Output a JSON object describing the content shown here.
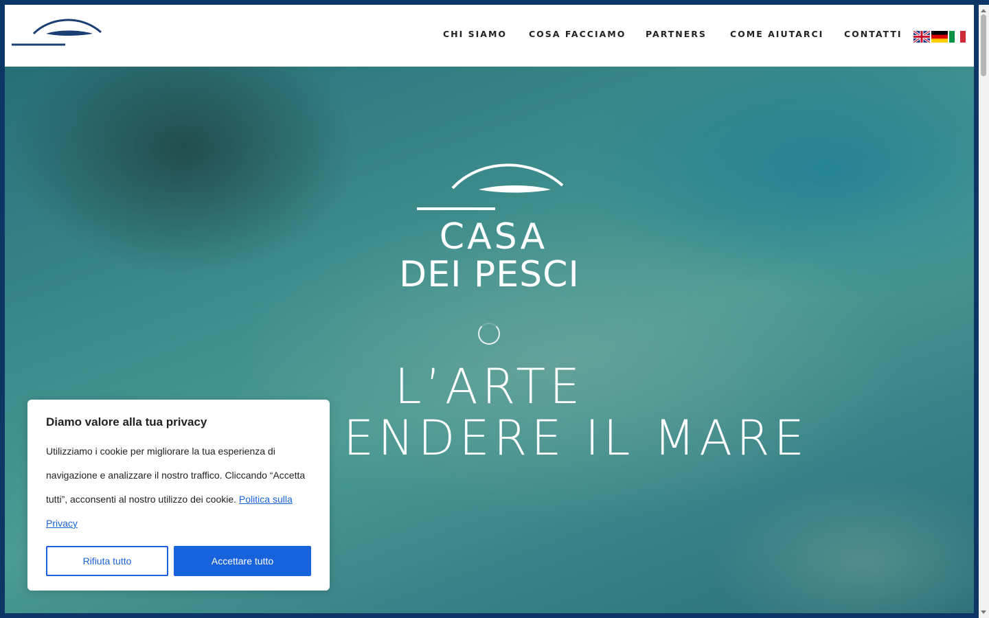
{
  "nav": {
    "items": [
      {
        "label": "CHI SIAMO"
      },
      {
        "label": "COSA FACCIAMO"
      },
      {
        "label": "PARTNERS"
      },
      {
        "label": "COME AIUTARCI"
      },
      {
        "label": "CONTATTI"
      }
    ]
  },
  "flags": [
    "english-flag-icon",
    "german-flag-icon",
    "italian-flag-icon"
  ],
  "hero": {
    "brand_line1": "CASA",
    "brand_line2": "DEI PESCI",
    "tagline_line1": "L’ARTE",
    "tagline_line2": "ENDERE IL MARE"
  },
  "cookie": {
    "title": "Diamo valore alla tua privacy",
    "text": "Utilizziamo i cookie per migliorare la tua esperienza di navigazione e analizzare il nostro traffico. Cliccando “Accetta tutti”, acconsenti al nostro utilizzo dei cookie.",
    "link_label": "Politica sulla Privacy",
    "reject_label": "Rifiuta tutto",
    "accept_label": "Accettare tutto"
  },
  "colors": {
    "brand_navy": "#1b3f73",
    "cookie_blue": "#1863dc"
  }
}
